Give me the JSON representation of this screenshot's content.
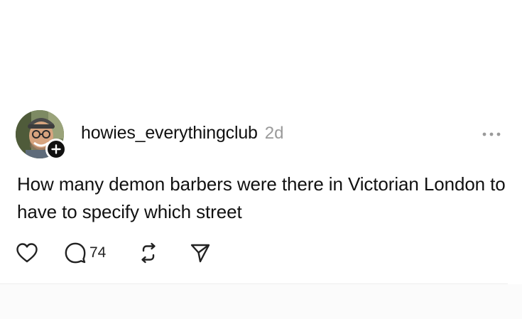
{
  "post": {
    "username": "howies_everythingclub",
    "time": "2d",
    "text": "How many demon barbers were there in Victorian London to have to specify which street",
    "reply_count": "74"
  },
  "icons": {
    "avatar": "avatar",
    "follow": "plus-icon",
    "more": "more-horizontal-icon",
    "like": "heart-icon",
    "reply": "speech-bubble-icon",
    "repost": "repost-icon",
    "share": "send-icon"
  },
  "colors": {
    "text": "#111111",
    "muted": "#9a9a9a",
    "background": "#ffffff"
  }
}
